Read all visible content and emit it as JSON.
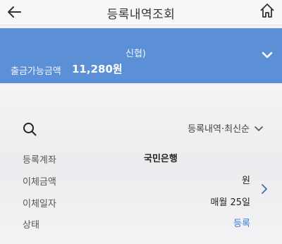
{
  "header": {
    "title": "등록내역조회",
    "back_icon": "back-arrow-icon",
    "home_icon": "home-icon"
  },
  "account": {
    "bank": "신협)",
    "available_label": "출금가능금액",
    "available_amount": "11,280원",
    "expand_icon": "chevron-down-icon",
    "color": "#5b8fd6"
  },
  "filter": {
    "search_icon": "search-icon",
    "sort_label": "등록내역·최신순",
    "sort_icon": "chevron-down-icon"
  },
  "registration": {
    "account_label": "등록계좌",
    "account_value": "국민은행",
    "amount_label": "이체금액",
    "amount_value": "원",
    "date_label": "이체일자",
    "date_value": "매월 25일",
    "status_label": "상태",
    "status_value": "등록",
    "status_color": "#3a7bd5",
    "detail_icon": "chevron-right-icon"
  }
}
